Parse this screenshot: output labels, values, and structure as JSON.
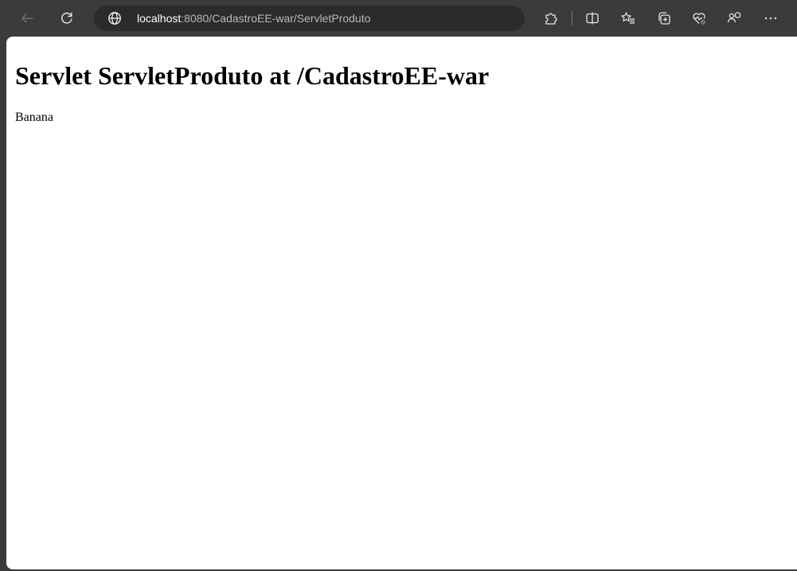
{
  "browser": {
    "url_host": "localhost",
    "url_rest": ":8080/CadastroEE-war/ServletProduto",
    "icons": {
      "back": "arrow-left-icon",
      "refresh": "refresh-icon",
      "site_info": "globe-icon",
      "extensions": "puzzle-icon",
      "split_screen": "split-screen-icon",
      "favorites": "favorites-icon",
      "collections": "collections-icon",
      "browser_essentials": "heart-pulse-icon",
      "copilot": "people-icon",
      "more": "more-icon"
    },
    "colors": {
      "toolbar_bg": "#3b3b3b",
      "address_bar_bg": "#2b2b2b",
      "page_bg": "#ffffff"
    }
  },
  "page": {
    "heading": "Servlet ServletProduto at /CadastroEE-war",
    "body_text": "Banana"
  }
}
